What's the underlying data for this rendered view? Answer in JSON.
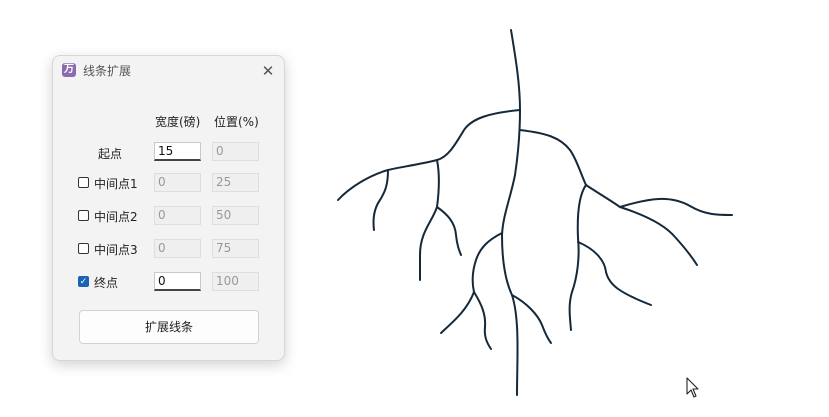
{
  "dialog": {
    "app_icon_glyph": "万",
    "title": "线条扩展",
    "close_glyph": "✕",
    "col_width_header": "宽度(磅)",
    "col_position_header": "位置(%)",
    "rows": [
      {
        "label": "起点",
        "checkbox": null,
        "width": "15",
        "position": "0"
      },
      {
        "label": "中间点1",
        "checkbox": false,
        "width": "0",
        "position": "25"
      },
      {
        "label": "中间点2",
        "checkbox": false,
        "width": "0",
        "position": "50"
      },
      {
        "label": "中间点3",
        "checkbox": false,
        "width": "0",
        "position": "75"
      },
      {
        "label": "终点",
        "checkbox": true,
        "width": "0",
        "position": "100"
      }
    ],
    "expand_button": "扩展线条"
  },
  "canvas": {
    "drawing": "tree-root-lines",
    "line_color": "#15293a"
  },
  "checkmark_glyph": "✓",
  "cursor": "mouse-pointer-icon"
}
